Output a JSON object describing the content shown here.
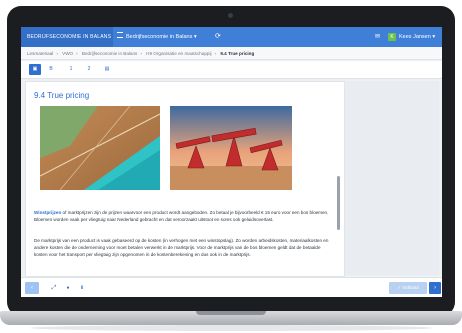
{
  "app": {
    "brand": "BEDRIJFSECONOMIE IN BALANS",
    "book": "Bedrijfseconomie in Balans",
    "user_initial": "K",
    "user_name": "Kees Jansen"
  },
  "breadcrumb": [
    "Lesmateriaal",
    "VWO",
    "Bedrijfseconomie in Balans",
    "H9 Organisatie en maatschappij",
    "9.4 True pricing"
  ],
  "toolbar": {
    "buttons": [
      "▣",
      "B",
      "1",
      "2",
      "▤"
    ]
  },
  "section": {
    "title": "9.4 True pricing",
    "paragraph1_highlight": "Winstprijzen",
    "paragraph1_rest": " of marktprijzen zijn de prijzen waarvoor een product wordt aangeboden. Zo betaal je bijvoorbeeld € 15 euro voor een bos bloemen. Bloemen worden vaak per vliegtuig naar Nederland gebracht en dat veroorzaakt uitstoot en soms ook geluidsoverlast.",
    "paragraph2": "De marktprijs van een product is vaak gebaseerd op de kosten (in verhogen met een winstopslag). Zo worden arbeidskosten, materiaalkosten en andere kosten die de onderneming voor moet betalen verwerkt in de marktprijs. Voor de marktprijs van de bos bloemen geldt dat de betaalde kosten voor het transport per vliegtuig zijn opgenomen in de kostenberekening en dus ook in de marktprijs."
  },
  "bottombar": {
    "prev": "‹",
    "expand": "⤢",
    "comment": "●",
    "pin": "⬇",
    "status": "✓ Voltooid",
    "next": "›"
  },
  "colors": {
    "accent": "#2f6fd0",
    "topbar": "#3f7fd8",
    "avatar": "#6cc24a"
  }
}
